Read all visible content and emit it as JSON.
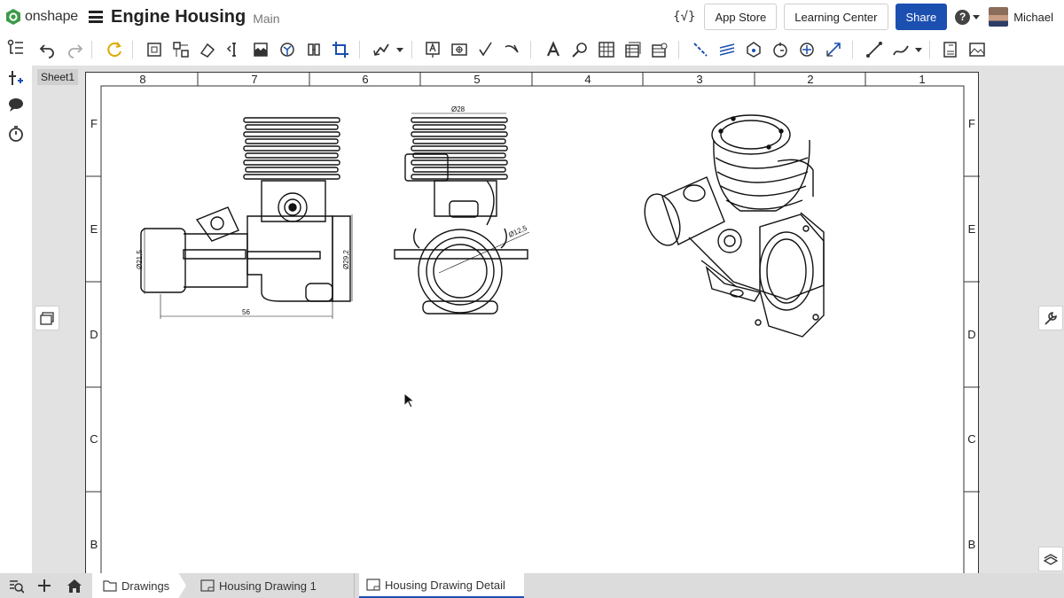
{
  "header": {
    "logo_text": "onshape",
    "doc_title": "Engine Housing",
    "doc_branch": "Main",
    "variables_label": "{√}",
    "app_store_label": "App Store",
    "learning_center_label": "Learning Center",
    "share_label": "Share",
    "help_label": "?",
    "user_name": "Michael"
  },
  "colors": {
    "accent": "#1b4fb0",
    "logo_green": "#3c9a48",
    "canvas_bg": "#e2e2e2",
    "tab_bar_bg": "#dcdcdc"
  },
  "toolbar": {
    "icons": [
      "undo-icon",
      "redo-icon",
      "regenerate-icon",
      "insert-view-icon",
      "projected-view-icon",
      "auxiliary-view-icon",
      "section-view-icon",
      "break-view-icon",
      "detail-view-icon",
      "crop-view-icon",
      "alternate-view-icon",
      "leader-icon",
      "note-icon",
      "datum-icon",
      "geometric-tolerance-icon",
      "surface-finish-icon",
      "text-icon",
      "inspection-icon",
      "table-icon",
      "bom-table-icon",
      "hole-table-icon",
      "line-icon",
      "hatch-icon",
      "centerline-icon",
      "centermark-icon",
      "point-icon",
      "dimension-icon",
      "sketch-line-icon",
      "spline-icon",
      "export-icon",
      "image-icon"
    ]
  },
  "sheet": {
    "tab_label": "Sheet1",
    "col_labels": [
      "8",
      "7",
      "6",
      "5",
      "4",
      "3",
      "2",
      "1"
    ],
    "row_labels": [
      "F",
      "E",
      "D",
      "C",
      "B"
    ],
    "dimensions": {
      "front_height": "Ø21,5",
      "front_right": "Ø29,2",
      "front_width": "56",
      "side_top": "Ø28",
      "side_diag": "Ø12,5"
    }
  },
  "bottom_tabs": {
    "folder_label": "Drawings",
    "drawing1_label": "Housing Drawing 1",
    "drawing2_label": "Housing Drawing Detail"
  }
}
